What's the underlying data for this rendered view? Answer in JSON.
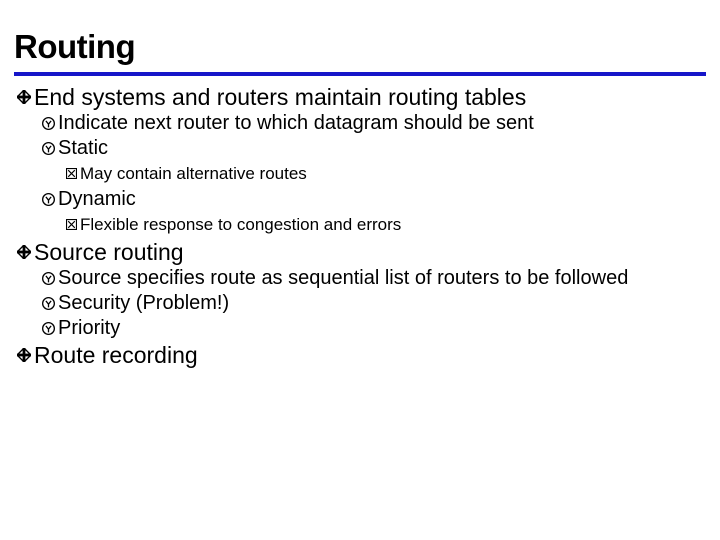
{
  "title": "Routing",
  "items": [
    {
      "level": 1,
      "text": "End systems and routers maintain routing tables"
    },
    {
      "level": 2,
      "text": "Indicate next router to which datagram should be sent",
      "wrap": true
    },
    {
      "level": 2,
      "text": "Static"
    },
    {
      "level": 3,
      "text": "May contain alternative routes"
    },
    {
      "level": 2,
      "text": "Dynamic"
    },
    {
      "level": 3,
      "text": "Flexible response to congestion and errors"
    },
    {
      "level": 1,
      "text": "Source routing"
    },
    {
      "level": 2,
      "text": "Source specifies route as sequential list of routers to be followed",
      "wrap": true
    },
    {
      "level": 2,
      "text": "Security  (Problem!)"
    },
    {
      "level": 2,
      "text": "Priority"
    },
    {
      "level": 1,
      "text": "Route recording"
    }
  ]
}
